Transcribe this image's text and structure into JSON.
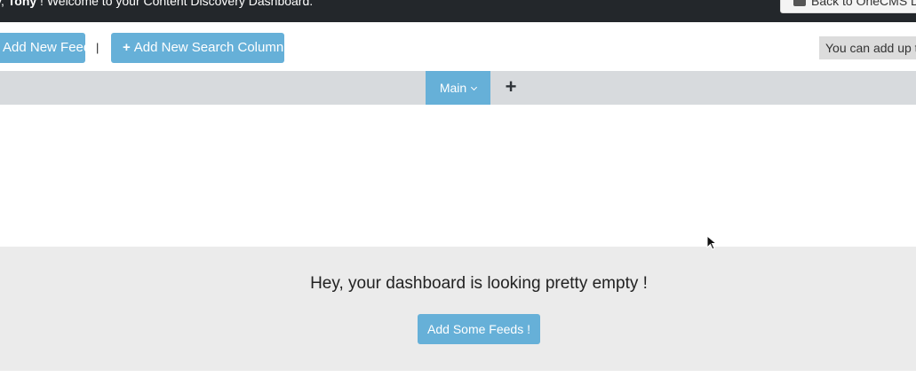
{
  "topbar": {
    "greeting_prefix": "y, ",
    "user_name": "Tony",
    "welcome_text": " ! Welcome to your Content Discovery Dashboard.",
    "back_button_label": "Back to OneCMS D"
  },
  "toolbar": {
    "add_feed_label": "Add New Feed",
    "add_search_label": "Add New Search Column",
    "separator": "|",
    "limit_notice": "You can add up to"
  },
  "tabs": {
    "main_label": "Main",
    "add_tab_label": "+"
  },
  "empty_state": {
    "message": "Hey, your dashboard is looking pretty empty !",
    "add_feeds_label": "Add Some Feeds !"
  },
  "colors": {
    "accent": "#66b0d8",
    "topbar": "#23272b",
    "tabbar": "#d7dadd",
    "empty_bg": "#ebebeb"
  }
}
